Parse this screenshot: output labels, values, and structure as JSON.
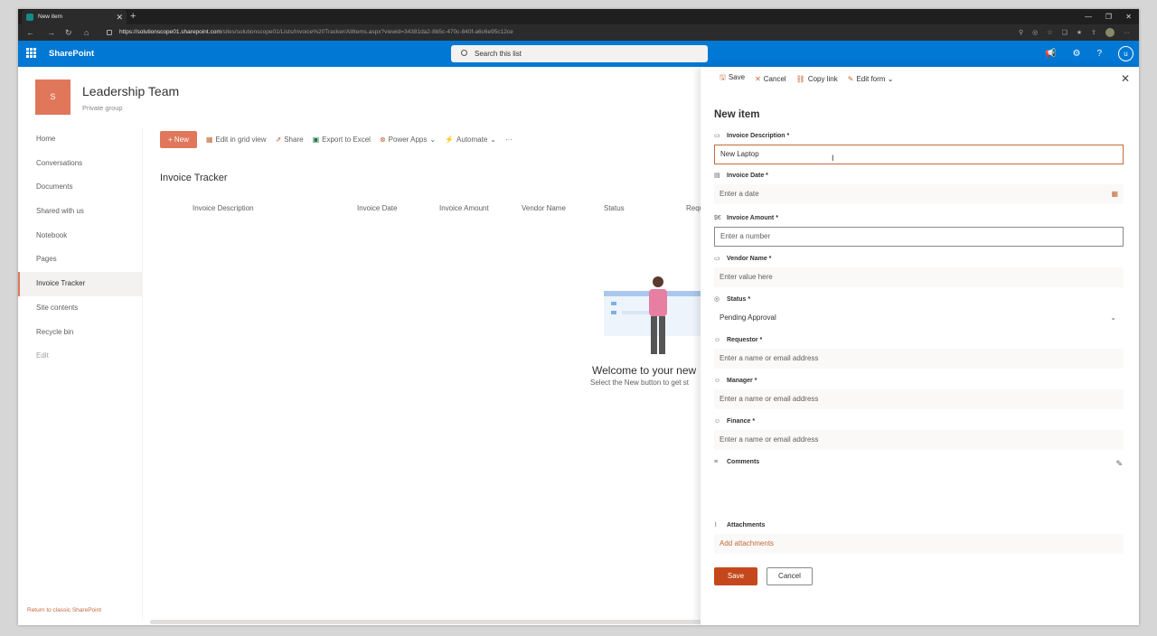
{
  "browser": {
    "tab_title": "New item",
    "url_host": "https://solutionscope01.sharepoint.com",
    "url_path": "/sites/solutionscope01/Lists/Invoice%20Tracker/AllItems.aspx?viewid=34381da2-8b5c-470c-840f-a6c6e95c12ce"
  },
  "suite": {
    "brand": "SharePoint",
    "search_placeholder": "Search this list",
    "user_initial": "u"
  },
  "site": {
    "logo_letter": "S",
    "title": "Leadership Team",
    "subtitle": "Private group"
  },
  "nav": {
    "items": [
      "Home",
      "Conversations",
      "Documents",
      "Shared with us",
      "Notebook",
      "Pages",
      "Invoice Tracker",
      "Site contents",
      "Recycle bin",
      "Edit"
    ],
    "classic_link": "Return to classic SharePoint"
  },
  "command_bar": {
    "new": "New",
    "grid": "Edit in grid view",
    "share": "Share",
    "export": "Export to Excel",
    "power_apps": "Power Apps",
    "automate": "Automate",
    "more": "···"
  },
  "list": {
    "title": "Invoice Tracker",
    "columns": [
      "Invoice Description",
      "Invoice Date",
      "Invoice Amount",
      "Vendor Name",
      "Status",
      "Requ"
    ],
    "welcome": "Welcome to your new",
    "welcome_sub": "Select the New button to get st"
  },
  "panel": {
    "toolbar": {
      "save": "Save",
      "cancel": "Cancel",
      "copy_link": "Copy link",
      "edit_form": "Edit form"
    },
    "title": "New item",
    "fields": {
      "description": {
        "label": "Invoice Description *",
        "value": "New Laptop"
      },
      "date": {
        "label": "Invoice Date *",
        "placeholder": "Enter a date"
      },
      "amount": {
        "label": "Invoice Amount *",
        "placeholder": "Enter a number"
      },
      "vendor": {
        "label": "Vendor Name *",
        "placeholder": "Enter value here"
      },
      "status": {
        "label": "Status *",
        "value": "Pending Approval"
      },
      "requestor": {
        "label": "Requestor *",
        "placeholder": "Enter a name or email address"
      },
      "manager": {
        "label": "Manager *",
        "placeholder": "Enter a name or email address"
      },
      "finance": {
        "label": "Finance *",
        "placeholder": "Enter a name or email address"
      },
      "comments": {
        "label": "Comments"
      },
      "attachments": {
        "label": "Attachments",
        "link": "Add attachments"
      }
    },
    "save_button": "Save",
    "cancel_button": "Cancel"
  },
  "colors": {
    "accent": "#c4481c",
    "suite": "#0078d4",
    "site_logo": "#e0775a"
  }
}
